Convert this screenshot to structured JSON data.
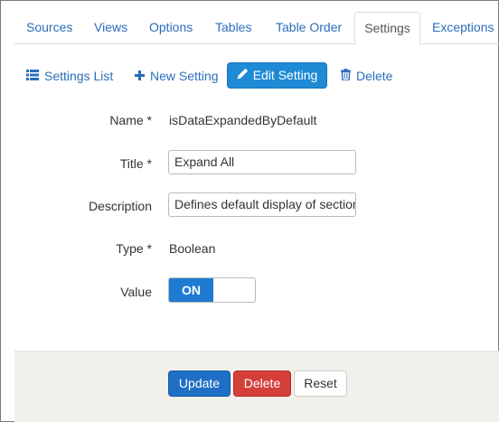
{
  "tabs": [
    {
      "label": "Sources"
    },
    {
      "label": "Views"
    },
    {
      "label": "Options"
    },
    {
      "label": "Tables"
    },
    {
      "label": "Table Order"
    },
    {
      "label": "Settings",
      "active": true
    },
    {
      "label": "Exceptions"
    }
  ],
  "toolbar": {
    "settings_list": "Settings List",
    "new_setting": "New Setting",
    "edit_setting": "Edit Setting",
    "delete": "Delete"
  },
  "form": {
    "name_label": "Name *",
    "name_value": "isDataExpandedByDefault",
    "title_label": "Title *",
    "title_value": "Expand All",
    "description_label": "Description",
    "description_value": "Defines default display of sections",
    "type_label": "Type *",
    "type_value": "Boolean",
    "value_label": "Value",
    "toggle_on": "ON",
    "toggle_state": true
  },
  "footer": {
    "update": "Update",
    "delete": "Delete",
    "reset": "Reset"
  },
  "colors": {
    "link": "#2a6ebb",
    "primary": "#1f8ad6",
    "danger": "#d43f3a",
    "footer_bg": "#f2f0ea"
  },
  "icons": {
    "settings_list": "list-icon",
    "new_setting": "plus-icon",
    "edit_setting": "pencil-icon",
    "delete": "trash-icon"
  }
}
